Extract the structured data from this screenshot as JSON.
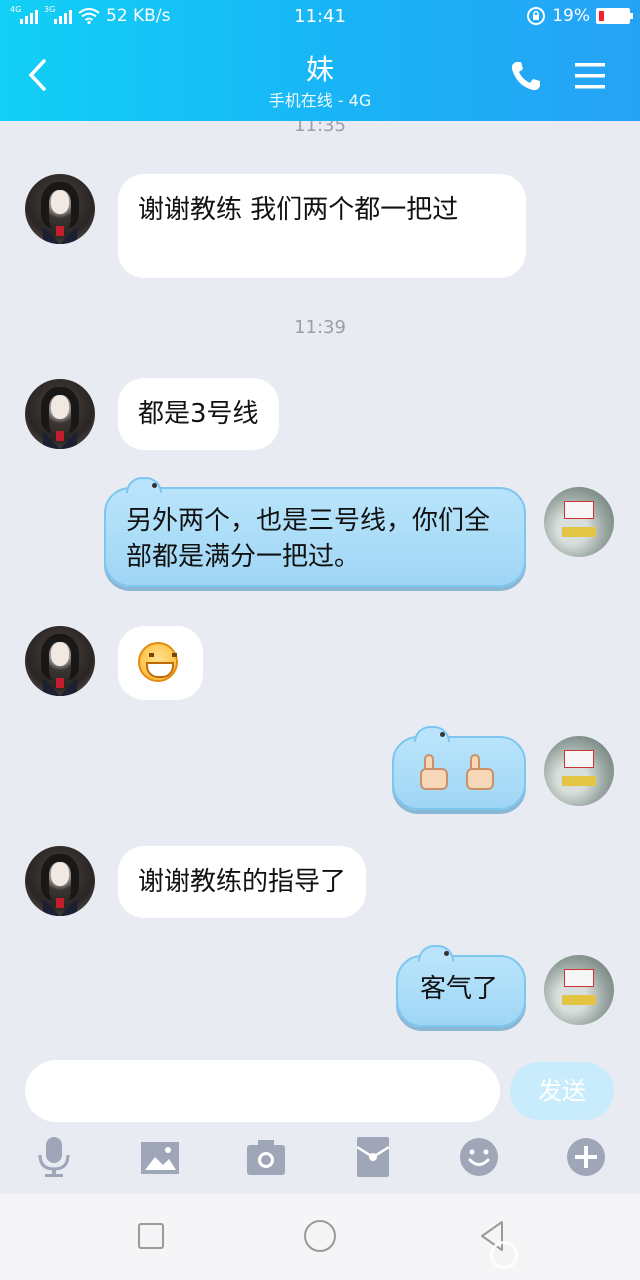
{
  "status_bar": {
    "network_left": "4G",
    "network_right": "3G",
    "speed": "52 KB/s",
    "time": "11:41",
    "battery": "19%",
    "battery_level": 0.19,
    "battery_color": "#f0232f"
  },
  "header": {
    "title": "妹",
    "subtitle": "手机在线 - 4G",
    "back_icon": "chevron-left-icon",
    "call_icon": "phone-icon",
    "menu_icon": "menu-icon"
  },
  "chat": {
    "timestamps": [
      "11:35",
      "11:39"
    ],
    "messages": [
      {
        "side": "in",
        "text": "谢谢教练  我们两个都一把过"
      },
      {
        "side": "in",
        "text": "都是3号线"
      },
      {
        "side": "out",
        "text": "另外两个，也是三号线，你们全部都是满分一把过。"
      },
      {
        "side": "in",
        "emoji": "grinning-face-icon"
      },
      {
        "side": "out",
        "emoji": "thumbs-up-icon x2"
      },
      {
        "side": "in",
        "text": "谢谢教练的指导了"
      },
      {
        "side": "out",
        "text": "客气了"
      }
    ]
  },
  "composer": {
    "input_value": "",
    "send_label": "发送"
  },
  "toolbar": [
    "microphone-icon",
    "image-icon",
    "camera-icon",
    "red-packet-icon",
    "emoji-icon",
    "plus-icon"
  ],
  "nav": [
    "recent-apps-icon",
    "home-icon",
    "back-icon"
  ]
}
